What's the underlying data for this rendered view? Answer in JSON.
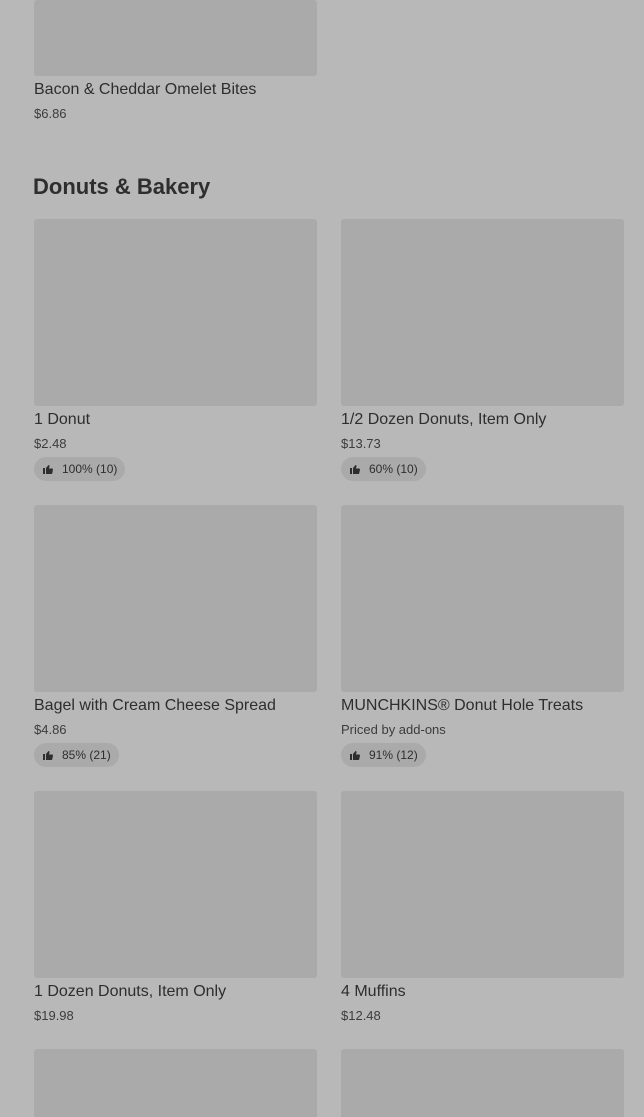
{
  "previous_section": {
    "items": [
      {
        "name": "Bacon & Cheddar Omelet Bites",
        "price": "$6.86"
      }
    ]
  },
  "section": {
    "title": "Donuts & Bakery",
    "items": [
      {
        "name": "1 Donut",
        "price": "$2.48",
        "rating": "100% (10)",
        "rating_icon": "thumbs-up-icon"
      },
      {
        "name": "1/2 Dozen Donuts, Item Only",
        "price": "$13.73",
        "rating": "60% (10)",
        "rating_icon": "thumbs-up-icon"
      },
      {
        "name": "Bagel with Cream Cheese Spread",
        "price": "$4.86",
        "rating": "85% (21)",
        "rating_icon": "thumbs-up-icon"
      },
      {
        "name": "MUNCHKINS® Donut Hole Treats",
        "price": "Priced by add-ons",
        "rating": "91% (12)",
        "rating_icon": "thumbs-up-icon"
      },
      {
        "name": "1 Dozen Donuts, Item Only",
        "price": "$19.98"
      },
      {
        "name": "4 Muffins",
        "price": "$12.48"
      }
    ]
  },
  "colors": {
    "background": "#b8b8b8",
    "image_placeholder": "#aaaaaa",
    "text": "#2e2e2e"
  }
}
